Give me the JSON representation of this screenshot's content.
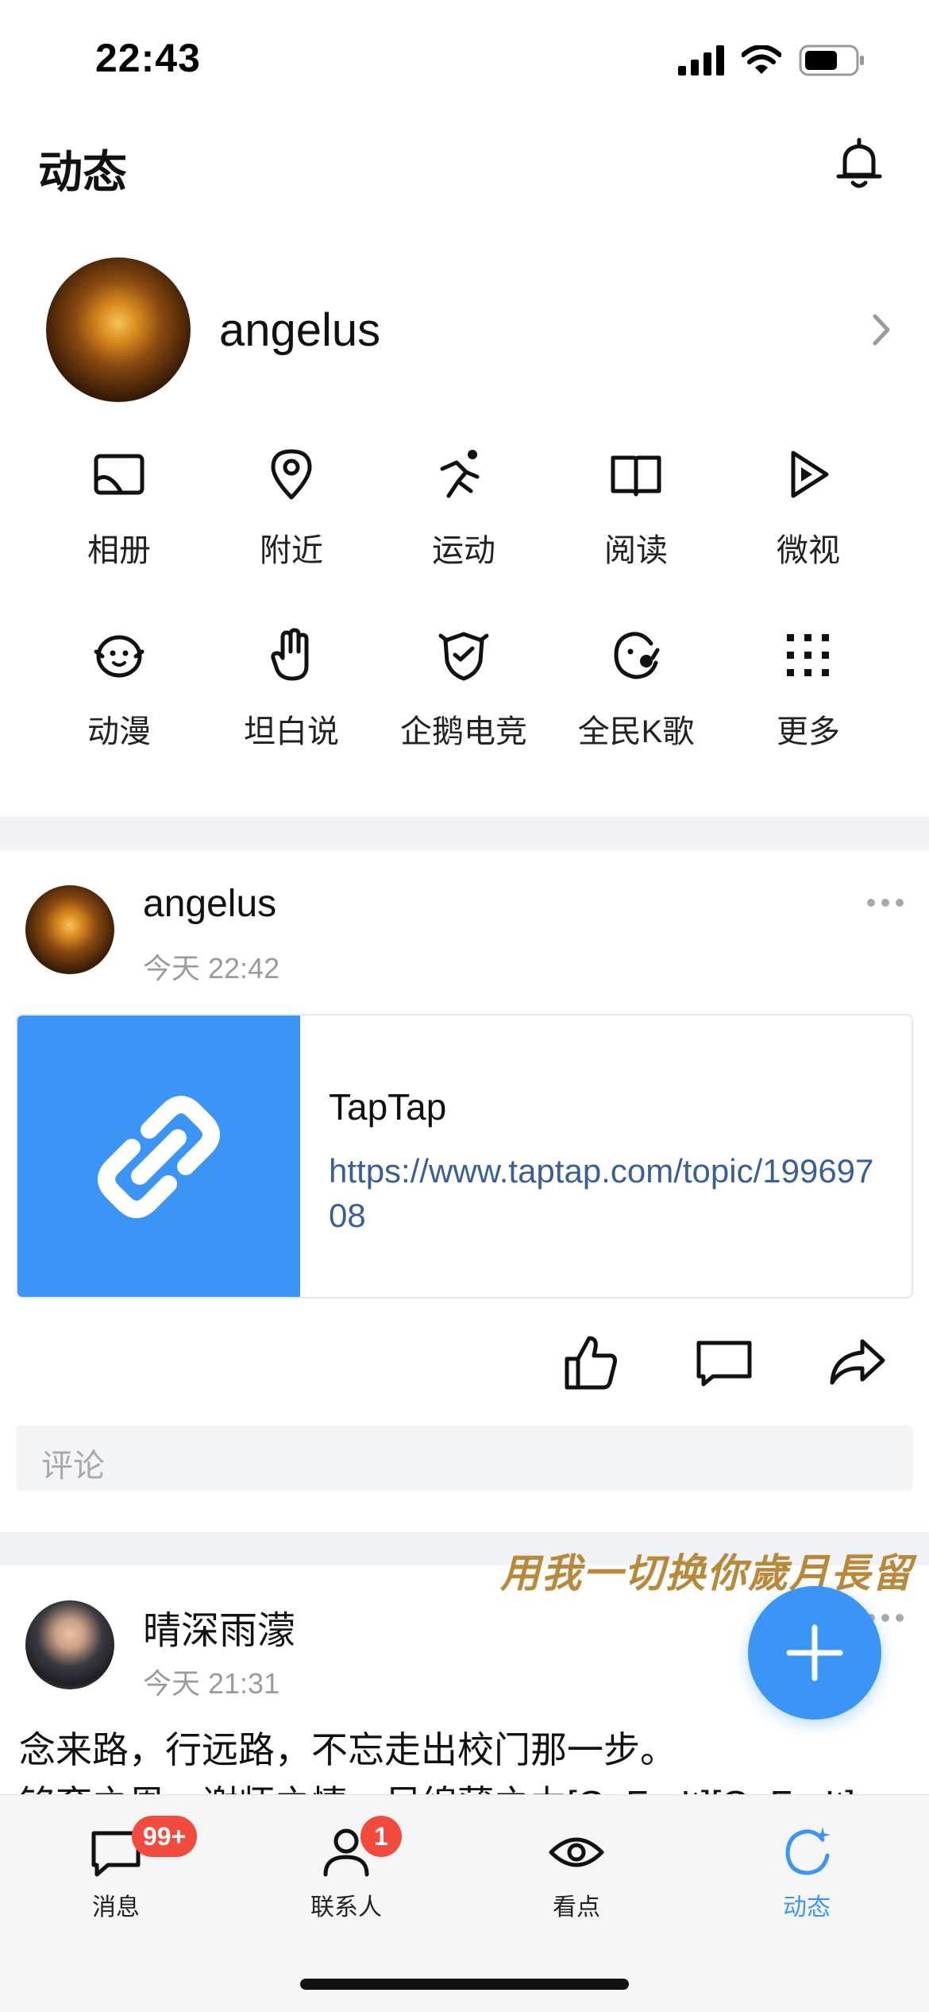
{
  "status": {
    "time": "22:43"
  },
  "header": {
    "title": "动态"
  },
  "profile": {
    "name": "angelus"
  },
  "grid": {
    "row1": [
      {
        "label": "相册",
        "icon": "album-icon"
      },
      {
        "label": "附近",
        "icon": "location-pin-icon"
      },
      {
        "label": "运动",
        "icon": "running-icon"
      },
      {
        "label": "阅读",
        "icon": "book-icon"
      },
      {
        "label": "微视",
        "icon": "play-icon"
      }
    ],
    "row2": [
      {
        "label": "动漫",
        "icon": "penguin-face-icon"
      },
      {
        "label": "坦白说",
        "icon": "hand-icon"
      },
      {
        "label": "企鹅电竞",
        "icon": "esports-shield-icon"
      },
      {
        "label": "全民K歌",
        "icon": "karaoke-icon"
      },
      {
        "label": "更多",
        "icon": "grid-dots-icon"
      }
    ]
  },
  "post1": {
    "author": "angelus",
    "time": "今天 22:42",
    "link": {
      "title": "TapTap",
      "url": "https://www.taptap.com/topic/19969708"
    },
    "comment_placeholder": "评论"
  },
  "banner_text": "用我一切换你歲月長留",
  "post2": {
    "author": "晴深雨濛",
    "time": "今天 21:31",
    "line1": "念来路，行远路，不忘走出校门那一步。",
    "line2": "铭育之恩，谢师之情，尽绵薄之力[GoForIt][GoForIt]"
  },
  "tabbar": {
    "tabs": [
      {
        "label": "消息",
        "badge": "99+"
      },
      {
        "label": "联系人",
        "badge": "1"
      },
      {
        "label": "看点"
      },
      {
        "label": "动态"
      }
    ]
  },
  "colors": {
    "accent": "#3b95f7",
    "badge": "#f24b3d",
    "link": "#3a5f95"
  }
}
